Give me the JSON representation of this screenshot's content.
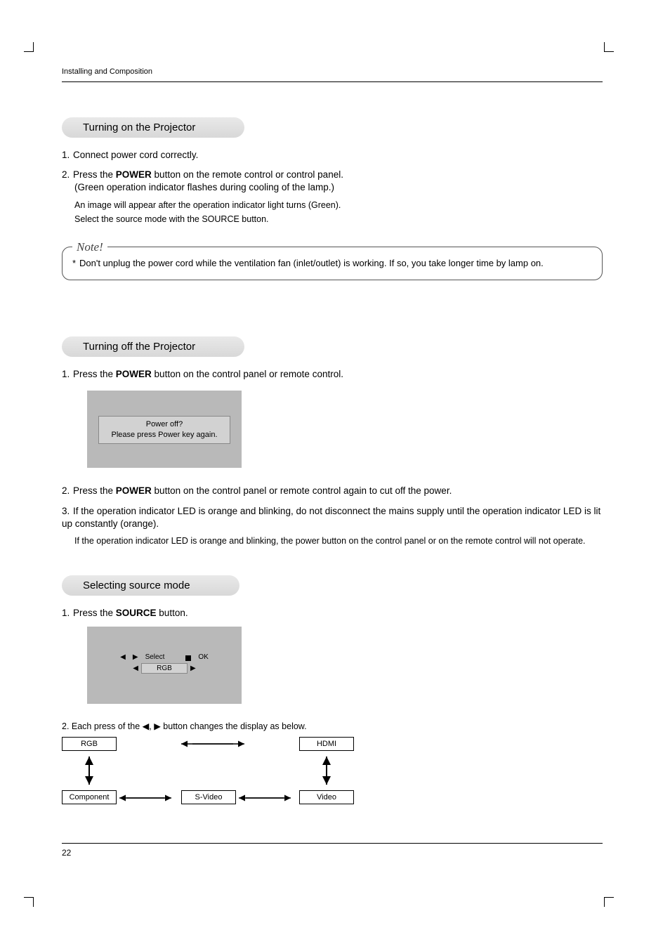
{
  "runningHead": "Installing and Composition",
  "pageNumber": "22",
  "section1": {
    "title": "Turning on the Projector",
    "step1": "Connect power cord correctly.",
    "step2_pre": "Press the ",
    "step2_bold": "POWER",
    "step2_post": " button on the remote control or control panel.",
    "step2_sub": "(Green operation indicator flashes during cooling of the lamp.)",
    "step2_note_l1": "An image will appear after the operation indicator light turns (Green).",
    "step2_note_l2": "Select the source mode with the SOURCE button."
  },
  "noteLabel": "Note!",
  "noteText": "Don't unplug the power cord while the ventilation fan (inlet/outlet) is working. If so, you take longer time by lamp on.",
  "section2": {
    "title": "Turning off the Projector",
    "step1_pre": "Press the ",
    "step1_bold": "POWER",
    "step1_post": " button on the control panel or remote control.",
    "dialog_l1": "Power off?",
    "dialog_l2": "Please press Power key again.",
    "step2_pre": "Press the ",
    "step2_bold": "POWER",
    "step2_post": " button on the control panel or remote control again to cut off the power.",
    "step3": "If the operation indicator LED is orange and blinking, do not disconnect the mains supply until the operation indicator LED is lit up constantly (orange).",
    "step3_sub": "If the operation indicator LED is  orange and blinking, the power button on the control panel or on the remote control will not operate."
  },
  "section3": {
    "title": "Selecting source mode",
    "step1_pre": "Press the ",
    "step1_bold": "SOURCE",
    "step1_post": " button.",
    "select_label": "Select",
    "ok_label": "OK",
    "chip": "RGB",
    "step2": "2. Each press of the ◀, ▶ button changes the display as below.",
    "nodes": {
      "rgb": "RGB",
      "hdmi": "HDMI",
      "component": "Component",
      "svideo": "S-Video",
      "video": "Video"
    }
  },
  "glyphs": {
    "triL": "◀",
    "triR": "▶"
  }
}
